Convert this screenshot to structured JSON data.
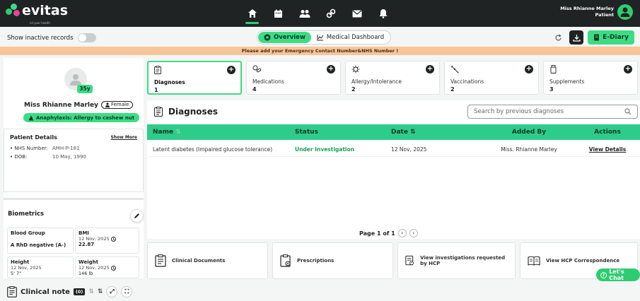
{
  "app": {
    "logo": "evitas",
    "tagline": "nil your health"
  },
  "user": {
    "name": "Miss Rhianne Marley",
    "role": "Patient"
  },
  "nav": [
    "home-icon",
    "calendar-icon",
    "people-icon",
    "link-icon",
    "mail-icon",
    "bell-icon"
  ],
  "toolbar": {
    "inactive_label": "Show inactive records",
    "tab_overview": "Overview",
    "tab_dashboard": "Medical Dashboard",
    "ediary": "E-Diary"
  },
  "banner": "Please add your Emergency Contact Number&NHS Number !",
  "patient": {
    "age": "35y",
    "name": "Miss Rhianne Marley",
    "gender": "Female",
    "allergy": "Anaphylaxis: Allergy to cashew nut",
    "details_title": "Patient Details",
    "show_more": "Show More",
    "nhs_label": "NHS Number:",
    "nhs_value": "AMH-P-181",
    "dob_label": "DOB:",
    "dob_value": "10 May, 1990"
  },
  "biometrics": {
    "title": "Biometrics",
    "blood_group": {
      "title": "Blood Group",
      "value": "A RhD negative (A-)"
    },
    "bmi": {
      "title": "BMI",
      "date": "12 Nov, 2025",
      "value": "22.87"
    },
    "height": {
      "title": "Height",
      "date": "12 Nov, 2025",
      "value": "5' 7\""
    },
    "weight": {
      "title": "Weight",
      "date": "12 Nov, 2025",
      "value": "146 lb"
    }
  },
  "summary_cards": [
    {
      "label": "Diagnoses",
      "count": "1"
    },
    {
      "label": "Medications",
      "count": "4"
    },
    {
      "label": "Allergy/Intolerance",
      "count": "2"
    },
    {
      "label": "Vaccinations",
      "count": "2"
    },
    {
      "label": "Supplements",
      "count": "3"
    }
  ],
  "diagnoses": {
    "title": "Diagnoses",
    "search_placeholder": "Search by previous diagnoses",
    "columns": [
      "Name",
      "Status",
      "Date",
      "Added By",
      "Actions"
    ],
    "rows": [
      {
        "name": "Latent diabetes (Impaired glucose tolerance)",
        "status": "Under Investigation",
        "date": "12 Nov, 2025",
        "added_by": "Miss. Rhianne Marley",
        "action": "View Details"
      }
    ],
    "pager": "Page 1 of 1"
  },
  "bottom_cards": [
    "Clinical Documents",
    "Prescriptions",
    "View investigations requested by HCP",
    "View HCP Correspondence"
  ],
  "chat": "Let's Chat",
  "clinical_note": {
    "label": "Clinical note",
    "count": "(0)"
  }
}
